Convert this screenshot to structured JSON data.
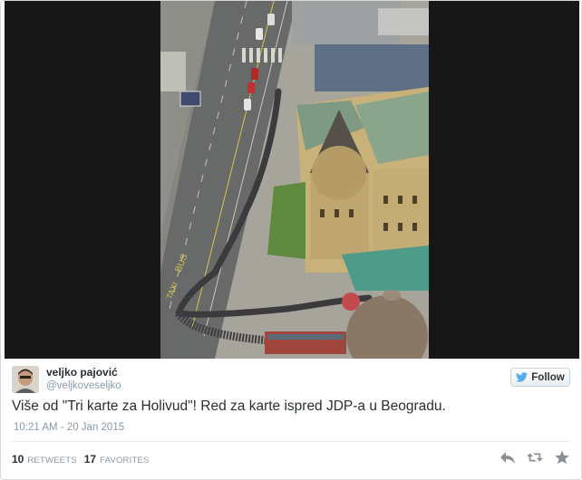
{
  "tweet": {
    "display_name": "veljko pajović",
    "screen_name": "@veljkoveseljko",
    "follow_label": "Follow",
    "text": "Više od \"Tri karte za Holivud\"! Red za karte ispred JDP-a u Beogradu.",
    "timestamp": "10:21 AM - 20 Jan 2015",
    "retweets": {
      "count": "10",
      "label": "Retweets"
    },
    "favorites": {
      "count": "17",
      "label": "Favorites"
    }
  },
  "icons": {
    "follow": "twitter-bird-icon",
    "reply": "reply-icon",
    "retweet": "retweet-icon",
    "favorite": "star-icon"
  },
  "colors": {
    "twitter_blue": "#55acee",
    "muted_text": "#8899a6",
    "primary_text": "#292f33",
    "action_icon": "#8a8f94"
  }
}
